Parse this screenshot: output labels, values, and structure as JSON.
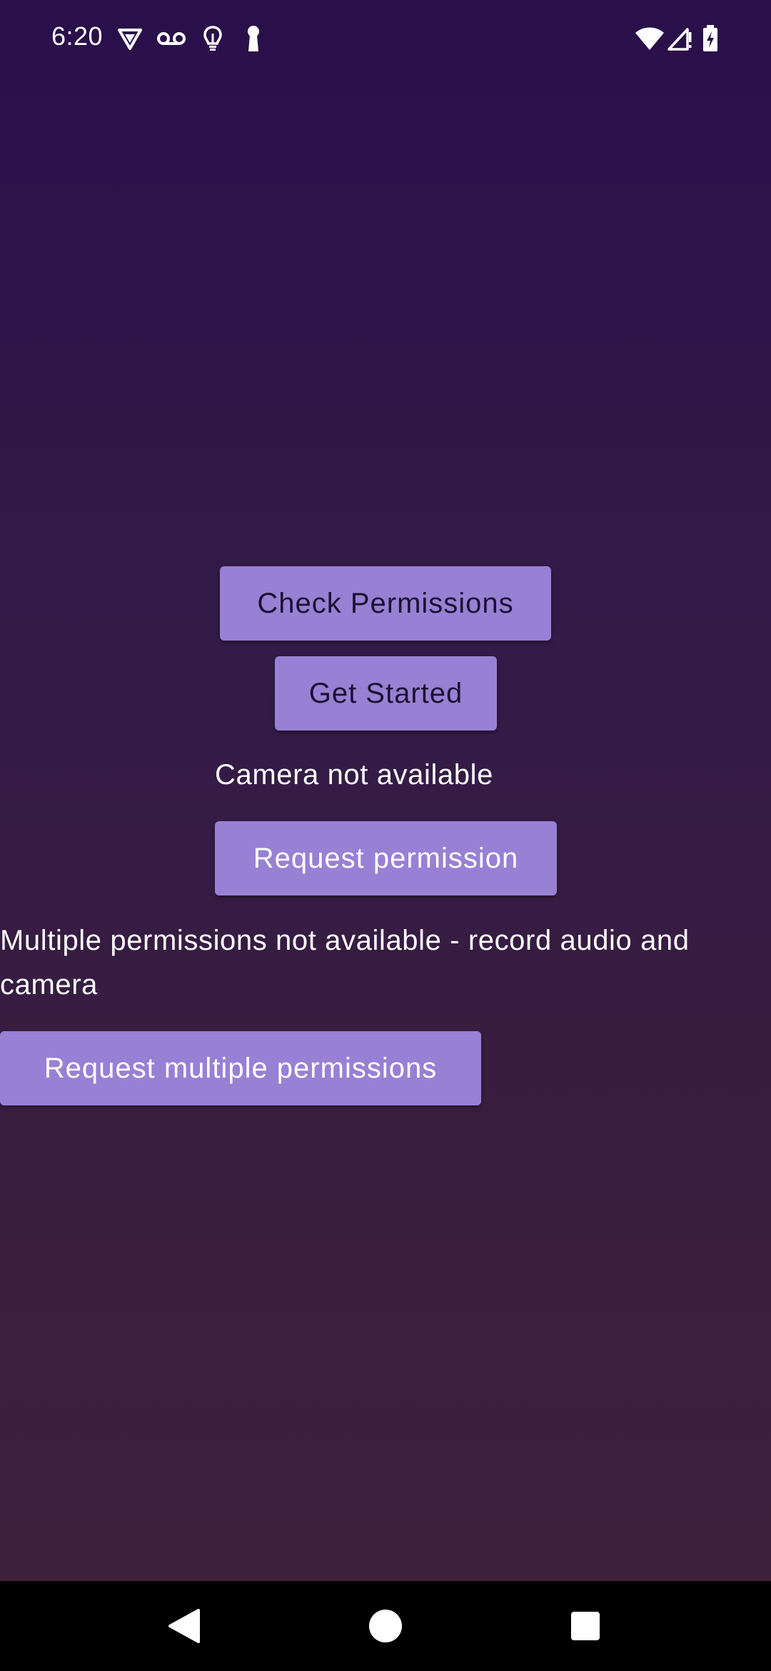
{
  "status_bar": {
    "time": "6:20",
    "left_icons": [
      "vpn-icon",
      "voicemail-icon",
      "bulb-icon",
      "keyhole-icon"
    ],
    "right_icons": [
      "wifi-icon",
      "cell-signal-icon",
      "battery-charging-icon"
    ]
  },
  "main": {
    "check_permissions_label": "Check Permissions",
    "get_started_label": "Get Started",
    "camera_status": "Camera not available",
    "request_permission_label": "Request permission",
    "multiple_status": "Multiple permissions not available - record audio and camera",
    "request_multiple_label": "Request multiple permissions"
  },
  "nav_bar": {
    "buttons": [
      "back-icon",
      "home-icon",
      "recents-icon"
    ]
  },
  "colors": {
    "background_top": "#2a0f4a",
    "background_bottom": "#3f1f3a",
    "button": "#9880d4",
    "nav_bar": "#000000"
  }
}
